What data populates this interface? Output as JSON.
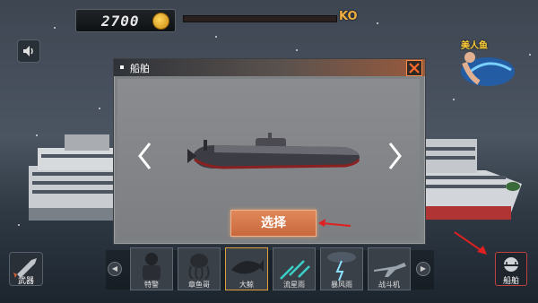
{
  "hud": {
    "coins": "2700",
    "ko_label": "KO",
    "progress_fraction": 0.0
  },
  "emblem": {
    "text": "美人鱼"
  },
  "dialog": {
    "title": "船舶",
    "select_label": "选择"
  },
  "bottom": {
    "weapon_label": "武器",
    "ship_label": "船舶",
    "items": [
      {
        "label": "特警",
        "icon": "soldier-icon"
      },
      {
        "label": "章鱼哥",
        "icon": "octopus-icon"
      },
      {
        "label": "大鲸",
        "icon": "whale-icon"
      },
      {
        "label": "流星雨",
        "icon": "meteor-icon"
      },
      {
        "label": "暴风雨",
        "icon": "storm-icon"
      },
      {
        "label": "战斗机",
        "icon": "jet-icon"
      }
    ]
  },
  "colors": {
    "accent": "#e07a48",
    "close": "#ff6a2a",
    "hint_arrow": "#e02020"
  }
}
